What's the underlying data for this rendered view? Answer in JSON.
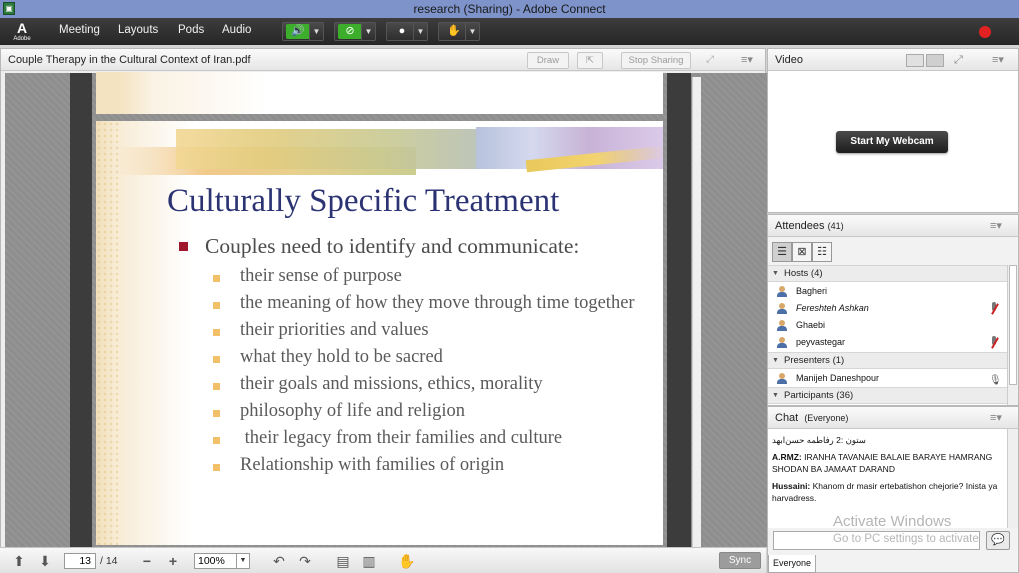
{
  "window": {
    "title": "research (Sharing) - Adobe Connect"
  },
  "menubar": {
    "logo_text": "A",
    "logo_sub": "Adobe",
    "items": [
      "Meeting",
      "Layouts",
      "Pods",
      "Audio"
    ]
  },
  "share_pod": {
    "title": "Couple Therapy in the Cultural Context of Iran.pdf",
    "draw_label": "Draw",
    "stop_sharing_label": "Stop Sharing",
    "menu_glyph": "≡▾"
  },
  "slide": {
    "title": "Culturally Specific Treatment",
    "main_point": "Couples need to identify and communicate:",
    "sub_points": [
      "their sense of purpose",
      "the meaning of how they move through time together",
      "their priorities and values",
      "what they hold to be sacred",
      "their goals and missions, ethics, morality",
      "philosophy of life and religion",
      " their legacy from their families and culture",
      "Relationship with families of origin"
    ],
    "colors": {
      "title": "#2b3373",
      "main_bullet": "#a0182c",
      "sub_bullet": "#f3c06a"
    }
  },
  "doc_toolbar": {
    "current_page": "13",
    "total_pages": "/ 14",
    "zoom": "100%",
    "sync_label": "Sync"
  },
  "video_pod": {
    "title": "Video",
    "webcam_button": "Start My Webcam"
  },
  "attendees_pod": {
    "title": "Attendees",
    "count": "(41)",
    "groups": {
      "hosts": "Hosts (4)",
      "presenters": "Presenters (1)",
      "participants": "Participants (36)"
    },
    "hosts": [
      "Bagheri",
      "Fereshteh Ashkan",
      "Ghaebi",
      "peyvastegar"
    ],
    "presenters": [
      "Manijeh Daneshpour"
    ]
  },
  "chat_pod": {
    "title": "Chat",
    "scope": "(Everyone)",
    "messages": [
      {
        "sender": "",
        "text": "ستون :2 رفاطمه حسن‌ابهد"
      },
      {
        "sender": "A.RMZ:",
        "text": " IRANHA TAVANAIE BALAIE BARAYE HAMRANG SHODAN BA JAMAAT DARAND"
      },
      {
        "sender": "Hussaini:",
        "text": " Khanom dr masir ertebatishon chejorie? Inista ya harvadress."
      }
    ],
    "tab_label": "Everyone"
  },
  "watermark": {
    "line1": "Activate Windows",
    "line2": "Go to PC settings to activate"
  },
  "colors": {
    "record": "#e22222",
    "titlebar": "#7d93c9"
  }
}
